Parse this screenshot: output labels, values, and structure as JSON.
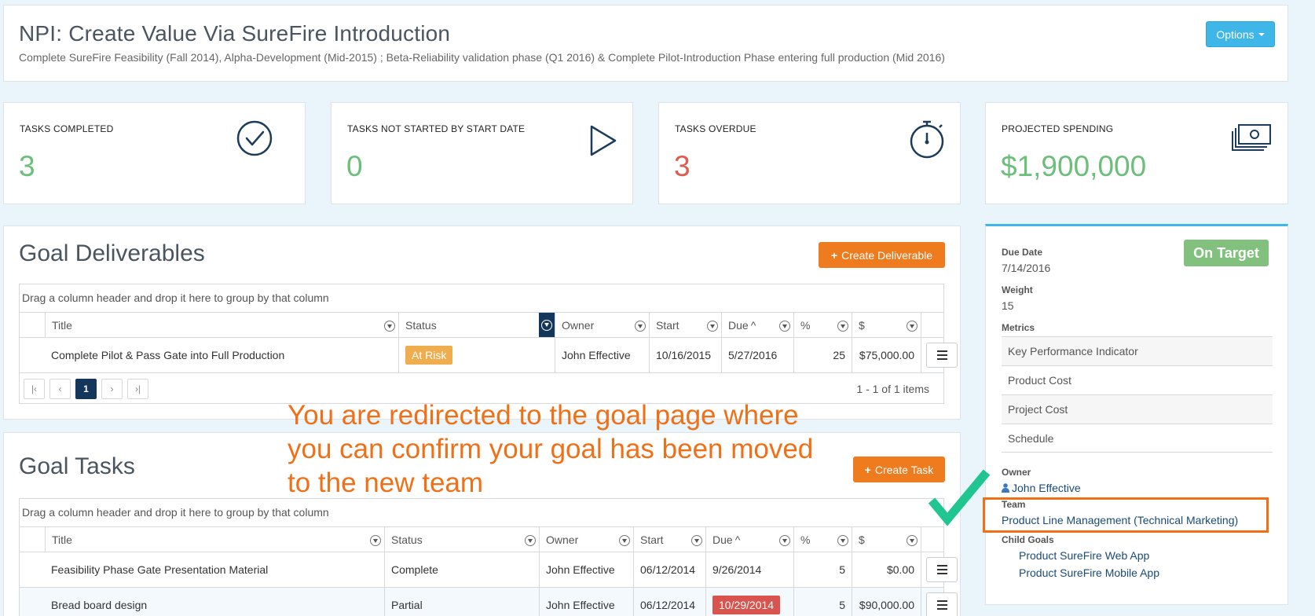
{
  "header": {
    "title": "NPI: Create Value Via SureFire Introduction",
    "subtitle": "Complete SureFire Feasibility (Fall 2014), Alpha-Development (Mid-2015) ; Beta-Reliability validation phase (Q1 2016) & Complete Pilot-Introduction Phase entering full production (Mid 2016)",
    "options_label": "Options"
  },
  "stats": {
    "completed": {
      "label": "TASKS COMPLETED",
      "value": "3",
      "icon": "check-circle-icon",
      "color": "#6cbf7a"
    },
    "not_started": {
      "label": "TASKS NOT STARTED BY START DATE",
      "value": "0",
      "icon": "play-icon",
      "color": "#6cbf7a"
    },
    "overdue": {
      "label": "TASKS OVERDUE",
      "value": "3",
      "icon": "stopwatch-icon",
      "color": "#e05a4f"
    },
    "spending": {
      "label": "PROJECTED SPENDING",
      "value": "$1,900,000",
      "icon": "cash-stack-icon",
      "color": "#6cbf7a"
    }
  },
  "deliverables": {
    "title": "Goal Deliverables",
    "create_label": "Create Deliverable",
    "group_hint": "Drag a column header and drop it here to group by that column",
    "columns": {
      "title": "Title",
      "status": "Status",
      "owner": "Owner",
      "start": "Start",
      "due": "Due",
      "pct": "%",
      "cost": "$"
    },
    "rows": [
      {
        "title": "Complete Pilot & Pass Gate into Full Production",
        "status": "At Risk",
        "owner": "John Effective",
        "start": "10/16/2015",
        "due": "5/27/2016",
        "pct": "25",
        "cost": "$75,000.00"
      }
    ],
    "pager": {
      "page": "1",
      "summary": "1 - 1 of 1 items"
    }
  },
  "tasks": {
    "title": "Goal Tasks",
    "create_label": "Create Task",
    "group_hint": "Drag a column header and drop it here to group by that column",
    "columns": {
      "title": "Title",
      "status": "Status",
      "owner": "Owner",
      "start": "Start",
      "due": "Due",
      "pct": "%",
      "cost": "$"
    },
    "rows": [
      {
        "title": "Feasibility Phase Gate Presentation Material",
        "status": "Complete",
        "owner": "John Effective",
        "start": "06/12/2014",
        "due": "9/26/2014",
        "pct": "5",
        "cost": "$0.00"
      },
      {
        "title": "Bread board design",
        "status": "Partial",
        "owner": "John Effective",
        "start": "06/12/2014",
        "due": "10/29/2014",
        "pct": "5",
        "cost": "$90,000.00"
      }
    ]
  },
  "detail": {
    "status_badge": "On Target",
    "due_date_label": "Due Date",
    "due_date": "7/14/2016",
    "weight_label": "Weight",
    "weight": "15",
    "metrics_label": "Metrics",
    "metrics": [
      "Key Performance Indicator",
      "Product Cost",
      "Project Cost",
      "Schedule"
    ],
    "owner_label": "Owner",
    "owner": "John Effective",
    "team_label": "Team",
    "team": "Product Line Management (Technical Marketing)",
    "child_goals_label": "Child Goals",
    "child_goals": [
      "Product SureFire Web App",
      "Product SureFire Mobile App"
    ]
  },
  "annotation": {
    "line1": "You are redirected to the goal page where",
    "line2": "you can confirm your goal has been  moved",
    "line3": "to the new team",
    "color": "#f07018"
  }
}
